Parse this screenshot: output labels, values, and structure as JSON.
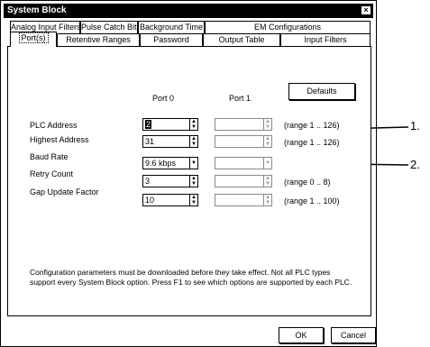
{
  "window": {
    "title": "System Block",
    "close_glyph": "×"
  },
  "tabs_row1": [
    "Analog Input Filters",
    "Pulse Catch Bits",
    "Background Time",
    "EM Configurations"
  ],
  "tabs_row2": [
    "Port(s)",
    "Retentive Ranges",
    "Password",
    "Output Table",
    "Input Filters"
  ],
  "active_tab": "Port(s)",
  "panel": {
    "defaults_button": "Defaults",
    "col_port0": "Port 0",
    "col_port1": "Port 1",
    "rows": [
      {
        "label": "PLC Address",
        "port0": "2",
        "range": "(range 1 .. 126)"
      },
      {
        "label": "Highest Address",
        "port0": "31",
        "range": "(range 1 .. 126)"
      },
      {
        "label": "Baud Rate",
        "port0": "9.6 kbps",
        "range": ""
      },
      {
        "label": "Retry Count",
        "port0": "3",
        "range": "(range 0 .. 8)"
      },
      {
        "label": "Gap Update Factor",
        "port0": "10",
        "range": "(range 1 .. 100)"
      }
    ],
    "note": "Configuration parameters must be downloaded before they take effect. Not all PLC types support every System Block option. Press F1 to see which options are supported by each PLC."
  },
  "buttons": {
    "ok": "OK",
    "cancel": "Cancel"
  },
  "callouts": [
    "1.",
    "2."
  ]
}
